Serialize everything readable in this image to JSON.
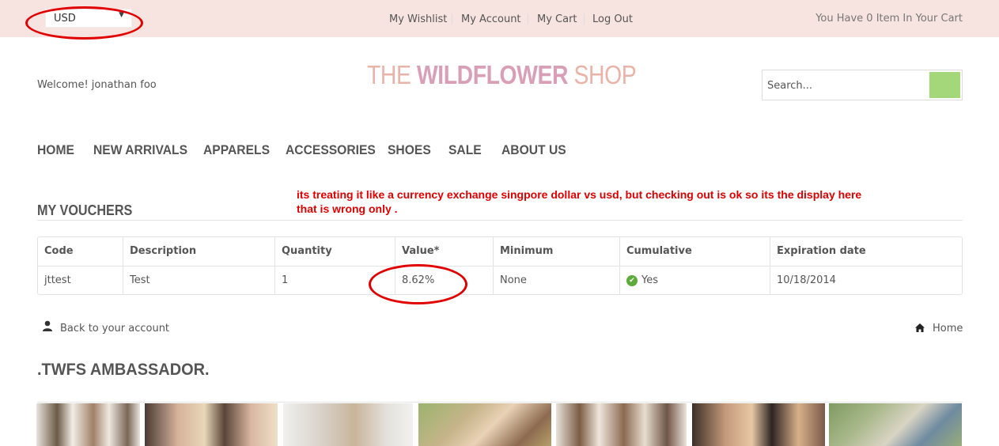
{
  "topbar": {
    "currency": "USD",
    "links": [
      "My Wishlist",
      "My Account",
      "My Cart",
      "Log Out"
    ],
    "cart_status": "You Have 0 Item In Your Cart"
  },
  "header": {
    "welcome": "Welcome! jonathan foo",
    "logo": {
      "part1": "THE ",
      "part2": "WILDFLOWER",
      "part3": " SHOP"
    },
    "search_placeholder": "Search..."
  },
  "nav": [
    "HOME",
    "NEW ARRIVALS",
    "APPARELS",
    "ACCESSORIES",
    "SHOES",
    "SALE",
    "ABOUT US"
  ],
  "vouchers": {
    "title": "MY VOUCHERS",
    "annotation": "its treating it like a currency exchange singpore dollar vs usd, but checking out is ok so its the display here that is wrong only .",
    "columns": [
      "Code",
      "Description",
      "Quantity",
      "Value*",
      "Minimum",
      "Cumulative",
      "Expiration date"
    ],
    "rows": [
      [
        "jttest",
        "Test",
        "1",
        "8.62%",
        "None",
        "Yes",
        "10/18/2014"
      ]
    ]
  },
  "footer_links": {
    "back": "Back to your account",
    "home": "Home"
  },
  "ambassador": {
    "title": ".TWFS AMBASSADOR."
  },
  "colors": {
    "topbar_bg": "#f7e3df",
    "search_button": "#a4d67a",
    "annotation_red": "#e10000",
    "logo_pink": "#e9b3a8",
    "logo_mauve": "#d99fb6"
  },
  "icons": [
    "chevron-down-icon",
    "search-icon",
    "check-circle-icon",
    "user-icon",
    "home-icon"
  ]
}
